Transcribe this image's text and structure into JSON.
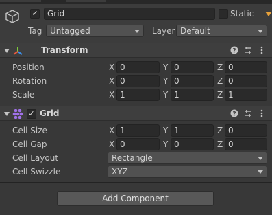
{
  "object": {
    "active": true,
    "name": "Grid",
    "static_label": "Static",
    "static_checked": false,
    "tag_label": "Tag",
    "tag_value": "Untagged",
    "layer_label": "Layer",
    "layer_value": "Default"
  },
  "transform": {
    "title": "Transform",
    "rows": [
      {
        "label": "Position",
        "x": "0",
        "y": "0",
        "z": "0"
      },
      {
        "label": "Rotation",
        "x": "0",
        "y": "0",
        "z": "0"
      },
      {
        "label": "Scale",
        "x": "1",
        "y": "1",
        "z": "1"
      }
    ]
  },
  "grid": {
    "enabled": true,
    "title": "Grid",
    "cell_size": {
      "label": "Cell Size",
      "x": "1",
      "y": "1",
      "z": "0"
    },
    "cell_gap": {
      "label": "Cell Gap",
      "x": "0",
      "y": "0",
      "z": "0"
    },
    "cell_layout": {
      "label": "Cell Layout",
      "value": "Rectangle"
    },
    "cell_swizzle": {
      "label": "Cell Swizzle",
      "value": "XYZ"
    }
  },
  "axes": {
    "x": "X",
    "y": "Y",
    "z": "Z"
  },
  "add_component_label": "Add Component",
  "icons": {
    "object": "gameobject-cube-icon",
    "transform": "transform-axes-icon",
    "grid": "grid-component-icon",
    "help": "help-icon",
    "presets": "presets-icon",
    "menu": "context-menu-icon"
  },
  "colors": {
    "panel": "#383838",
    "header": "#3e3e3e",
    "field": "#2a2a2a",
    "accent": "#e8a13a"
  }
}
